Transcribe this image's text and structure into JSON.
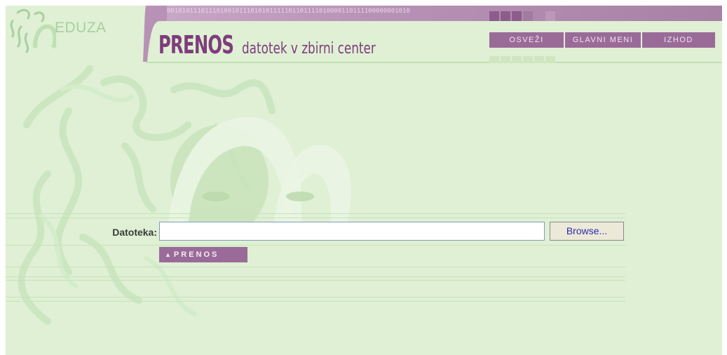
{
  "header": {
    "logo_text": "EDUZA",
    "title_main": "PRENOS",
    "title_sub": "datotek v zbirni center",
    "binary_strip": "0010101110111010010111010101111101101111010000110111100000001010",
    "nav": [
      {
        "label": "OSVEŽI",
        "icon": "refresh"
      },
      {
        "label": "GLAVNI MENI",
        "icon": "menu"
      },
      {
        "label": "IZHOD",
        "icon": "exit"
      }
    ]
  },
  "form": {
    "file_label": "Datoteka:",
    "file_value": "",
    "browse_label": "Browse...",
    "submit_label": "PRENOS",
    "submit_icon": "triangle-up-icon"
  },
  "colors": {
    "background": "#dff0d4",
    "accent_purple": "#9a6b98",
    "title_purple": "#7e3d7c",
    "logo_green": "#a9cfa0"
  }
}
